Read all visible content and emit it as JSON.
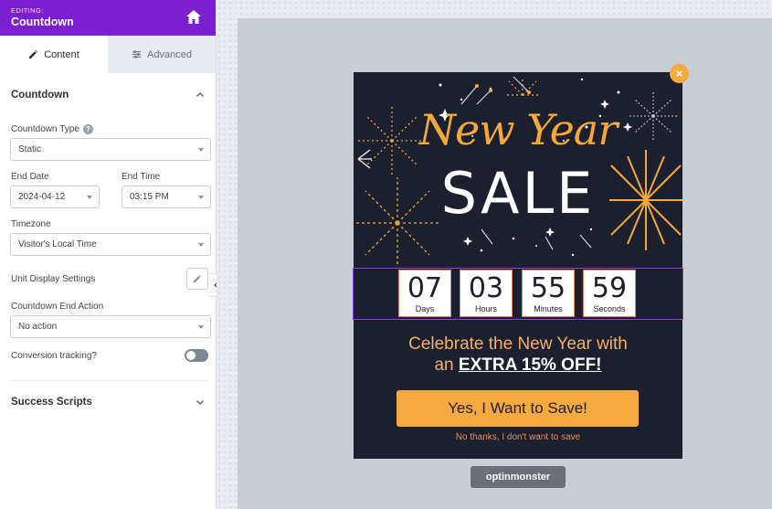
{
  "header": {
    "editing_label": "EDITING:",
    "title": "Countdown"
  },
  "tabs": [
    {
      "label": "Content"
    },
    {
      "label": "Advanced"
    }
  ],
  "countdown_section": {
    "title": "Countdown",
    "type_label": "Countdown Type",
    "type_value": "Static",
    "end_date_label": "End Date",
    "end_date_value": "2024-04-12",
    "end_time_label": "End Time",
    "end_time_value": "03:15 PM",
    "timezone_label": "Timezone",
    "timezone_value": "Visitor's Local Time",
    "unit_display_label": "Unit Display Settings",
    "end_action_label": "Countdown End Action",
    "end_action_value": "No action",
    "conversion_label": "Conversion tracking?",
    "conversion_enabled": false
  },
  "success_section": {
    "title": "Success Scripts"
  },
  "popup": {
    "headline_script": "New Year",
    "headline_main": "SALE",
    "countdown": [
      {
        "value": "07",
        "unit": "Days"
      },
      {
        "value": "03",
        "unit": "Hours"
      },
      {
        "value": "55",
        "unit": "Minutes"
      },
      {
        "value": "59",
        "unit": "Seconds"
      }
    ],
    "promo_line1": "Celebrate the New Year with",
    "promo_line2_prefix": "an",
    "promo_line2_bold": "EXTRA 15% OFF!",
    "cta_label": "Yes, I Want to Save!",
    "decline_label": "No thanks, I don't want to save",
    "close_symbol": "×"
  },
  "branding": {
    "badge": "optinmonster"
  },
  "colors": {
    "sidebar_header": "#7b1fd0",
    "popup_bg": "#1c1f2e",
    "accent_orange": "#f5a93e",
    "selection_outline": "#8a3ffc"
  },
  "icons": {
    "home": "home-icon",
    "content_tab": "pencil-icon",
    "advanced_tab": "sliders-icon",
    "help": "question-circle-icon",
    "collapse": "chevron-up-icon",
    "expand": "chevron-down-icon",
    "panel_toggle": "chevron-left-icon",
    "close": "close-icon"
  }
}
